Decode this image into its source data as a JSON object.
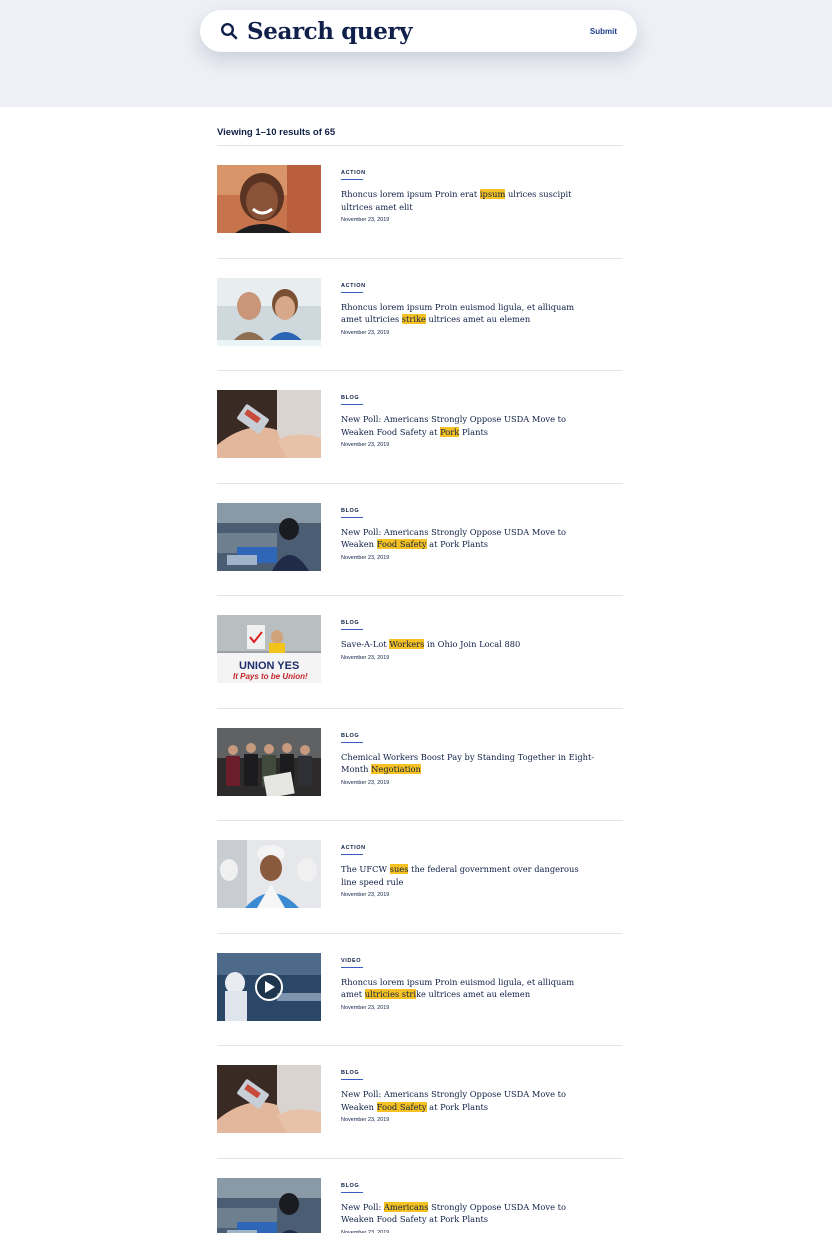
{
  "search": {
    "query": "Search query",
    "submit_label": "Submit"
  },
  "results_summary": "Viewing 1–10 results of 65",
  "results": [
    {
      "category": "ACTION",
      "title_parts": [
        {
          "t": "Rhoncus lorem ipsum Proin erat "
        },
        {
          "t": "ipsum",
          "hl": true
        },
        {
          "t": " ulrices suscipit ultrices amet elit"
        }
      ],
      "date": "November 23, 2019",
      "thumbnail": "smiling-woman-photo"
    },
    {
      "category": "ACTION",
      "title_parts": [
        {
          "t": "Rhoncus lorem ipsum Proin euismod ligula, et alliquam amet ultricies "
        },
        {
          "t": "strike",
          "hl": true
        },
        {
          "t": " ultrices amet au elemen"
        }
      ],
      "date": "November 23, 2019",
      "thumbnail": "two-women-photo"
    },
    {
      "category": "BLOG",
      "title_parts": [
        {
          "t": "New Poll: Americans Strongly Oppose USDA Move to Weaken Food Safety at "
        },
        {
          "t": "Pork",
          "hl": true
        },
        {
          "t": " Plants"
        }
      ],
      "date": "November 23, 2019",
      "thumbnail": "hand-holding-package-photo"
    },
    {
      "category": "BLOG",
      "title_parts": [
        {
          "t": "New Poll: Americans Strongly Oppose USDA Move to Weaken "
        },
        {
          "t": "Food Safety",
          "hl": true
        },
        {
          "t": " at Pork Plants"
        }
      ],
      "date": "November 23, 2019",
      "thumbnail": "factory-worker-photo"
    },
    {
      "category": "BLOG",
      "title_parts": [
        {
          "t": "Save-A-Lot "
        },
        {
          "t": "Workers",
          "hl": true
        },
        {
          "t": " in Ohio Join Local 880"
        }
      ],
      "date": "November 23, 2019",
      "thumbnail": "union-yes-banner-photo"
    },
    {
      "category": "BLOG",
      "title_parts": [
        {
          "t": "Chemical Workers Boost Pay by Standing Together in Eight-Month "
        },
        {
          "t": "Negotiation",
          "hl": true
        }
      ],
      "date": "November 23, 2019",
      "thumbnail": "group-of-workers-photo"
    },
    {
      "category": "ACTION",
      "title_parts": [
        {
          "t": "The UFCW "
        },
        {
          "t": "sues",
          "hl": true
        },
        {
          "t": " the federal government over dangerous line speed rule"
        }
      ],
      "date": "November 23, 2019",
      "thumbnail": "worker-in-hardhat-photo"
    },
    {
      "category": "VIDEO",
      "title_parts": [
        {
          "t": "Rhoncus lorem ipsum Proin euismod ligula, et alliquam amet "
        },
        {
          "t": "ultricies stri",
          "hl": true
        },
        {
          "t": "ke ultrices amet au elemen"
        }
      ],
      "date": "November 23, 2019",
      "thumbnail": "video-processing-line-photo"
    },
    {
      "category": "BLOG",
      "title_parts": [
        {
          "t": "New Poll: Americans Strongly Oppose USDA Move to Weaken "
        },
        {
          "t": "Food Safety",
          "hl": true
        },
        {
          "t": " at Pork Plants"
        }
      ],
      "date": "November 23, 2019",
      "thumbnail": "hand-holding-package-photo"
    },
    {
      "category": "BLOG",
      "title_parts": [
        {
          "t": "New Poll: "
        },
        {
          "t": "Americans",
          "hl": true
        },
        {
          "t": " Strongly Oppose USDA Move to Weaken Food Safety at Pork Plants"
        }
      ],
      "date": "November 23, 2019",
      "thumbnail": "factory-worker-photo"
    }
  ]
}
